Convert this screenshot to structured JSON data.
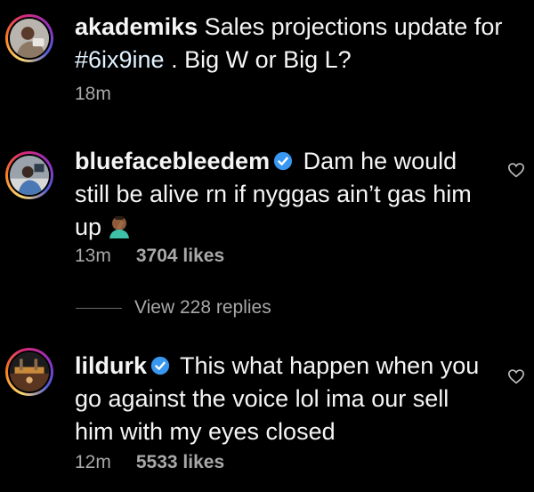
{
  "comments": [
    {
      "username": "akademiks",
      "verified": false,
      "text_before": "Sales projections update for ",
      "hashtag": "#6ix9ine",
      "text_after": " . Big W or Big L?",
      "time": "18m",
      "likes": "",
      "avatar_icon": "profile-photo",
      "has_heart": false
    },
    {
      "username": "bluefacebleedem",
      "verified": true,
      "text": "Dam he would still be alive rn if nyggas ain’t gas him up",
      "emoji": "face-palm-emoji",
      "time": "13m",
      "likes": "3704 likes",
      "avatar_icon": "profile-photo",
      "has_heart": true
    },
    {
      "username": "lildurk",
      "verified": true,
      "text": "This what happen when you go against the voice lol ima our sell him with my eyes closed",
      "time": "12m",
      "likes": "5533 likes",
      "avatar_icon": "profile-photo",
      "has_heart": true
    }
  ],
  "view_replies": "View 228 replies",
  "colors": {
    "background": "#000000",
    "text": "#f5f5f5",
    "meta": "#a8a8a8",
    "verified": "#3897f0",
    "hashtag": "#e0f1ff"
  }
}
